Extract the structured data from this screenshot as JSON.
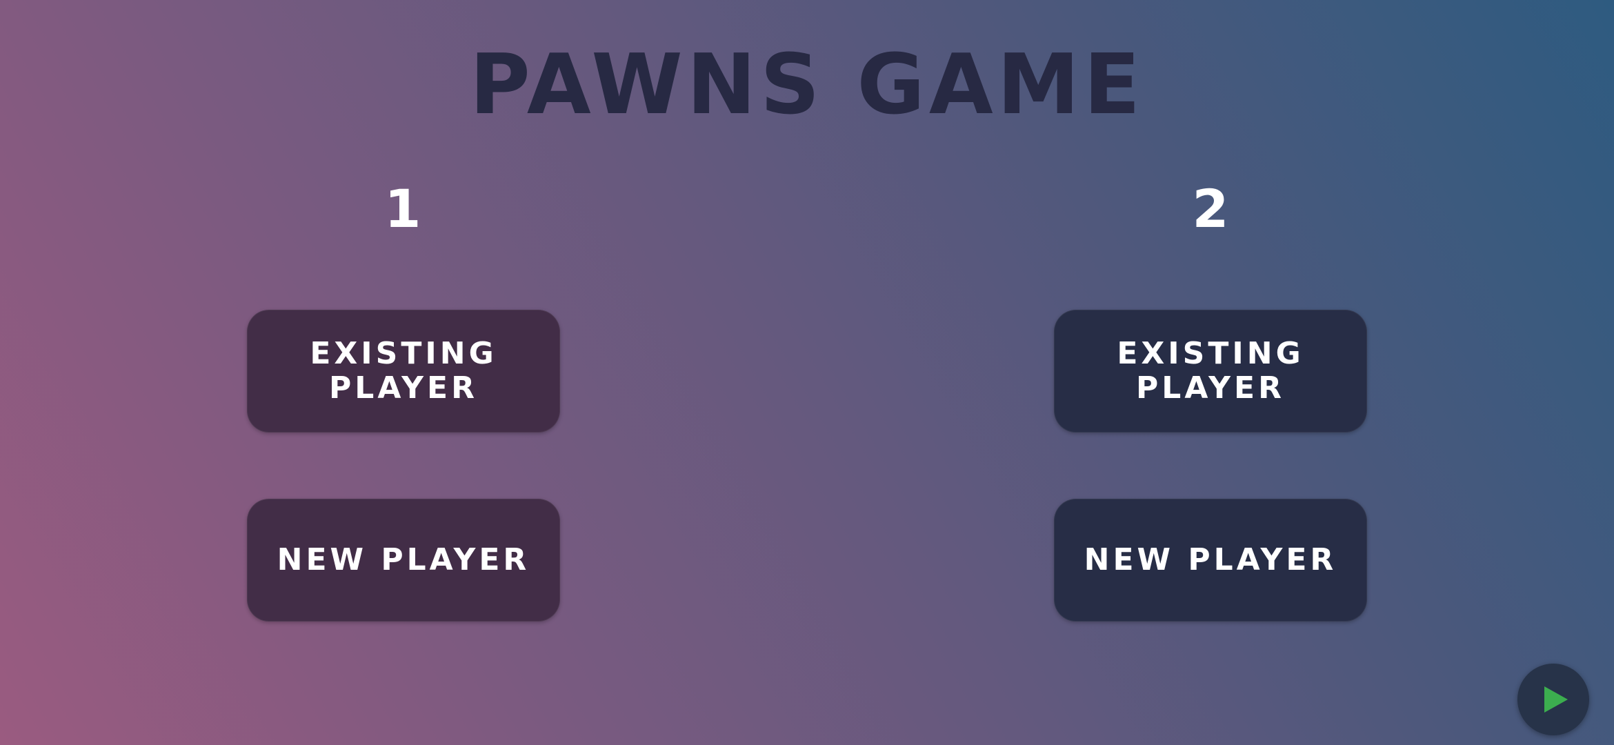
{
  "title": "PAWNS GAME",
  "players": [
    {
      "number": "1",
      "existing_label": "EXISTING PLAYER",
      "new_label": "NEW PLAYER"
    },
    {
      "number": "2",
      "existing_label": "EXISTING PLAYER",
      "new_label": "NEW PLAYER"
    }
  ],
  "play_button": {
    "icon": "play-icon"
  },
  "colors": {
    "title": "#272943",
    "player1_button": "#422d47",
    "player2_button": "#272d46",
    "play_button": "#273349",
    "play_icon": "#3cae4f"
  }
}
